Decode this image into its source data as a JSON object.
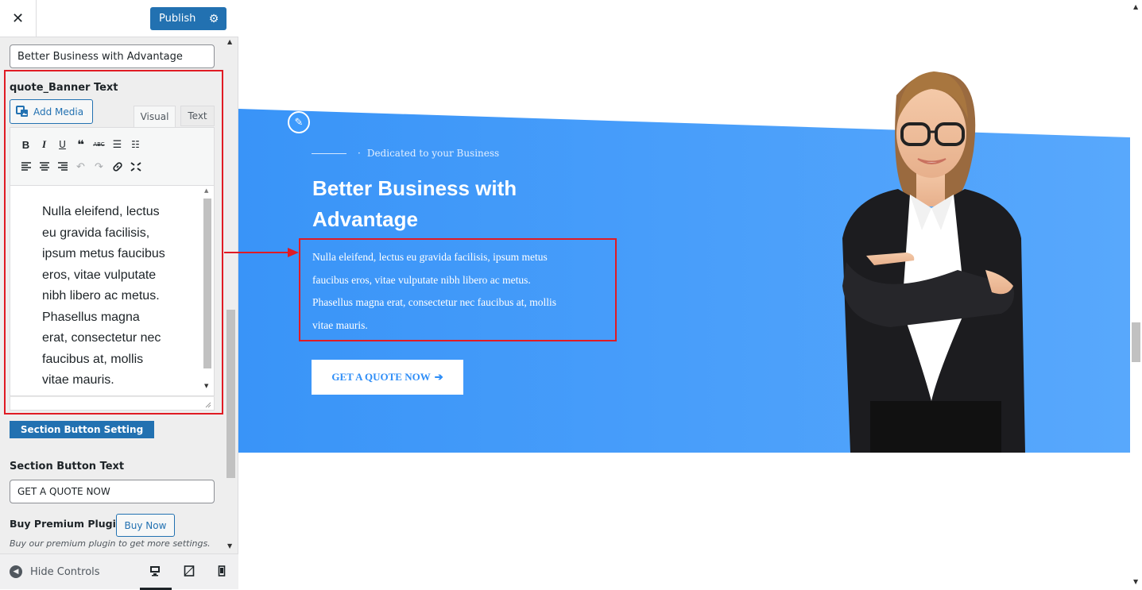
{
  "topbar": {
    "close_label": "✕",
    "publish_label": "Publish"
  },
  "sidebar": {
    "title_value": "Better Business with Advantage",
    "quote_label": "quote_Banner Text",
    "add_media_label": "Add Media",
    "tab_visual": "Visual",
    "tab_text": "Text",
    "toolbar_row1": [
      "B",
      "I",
      "U",
      "❝",
      "ABC",
      "list",
      "olist"
    ],
    "toolbar_row2": [
      "align-left",
      "align-center",
      "align-right",
      "undo",
      "redo",
      "link",
      "fullscreen"
    ],
    "editor_lines": [
      "Nulla eleifend, lectus",
      "eu gravida facilisis,",
      "ipsum metus faucibus",
      "eros, vitae vulputate",
      "nibh libero ac metus.",
      "Phasellus magna",
      "erat, consectetur nec",
      "faucibus at, mollis",
      "vitae mauris."
    ],
    "section_button_setting": "Section Button Setting",
    "section_button_text_label": "Section Button Text",
    "section_button_text_value": "GET A QUOTE NOW",
    "premium_label": "Buy Premium Plugin",
    "buy_now_label": "Buy Now",
    "premium_desc": "Buy our premium plugin to get more settings."
  },
  "bottombar": {
    "hide_controls": "Hide Controls"
  },
  "preview": {
    "tagline": "Dedicated to your Business",
    "title_line1": "Better Business with",
    "title_line2": "Advantage",
    "para_lines": [
      "Nulla eleifend, lectus eu gravida facilisis, ipsum metus",
      "faucibus eros, vitae vulputate nibh libero ac metus.",
      "Phasellus magna erat, consectetur nec faucibus at, mollis",
      "vitae mauris."
    ],
    "quote_button": "GET A QUOTE NOW",
    "banner_color_left": "#3994f8",
    "banner_color_right": "#58a8fc"
  },
  "colors": {
    "accent": "#2271b1",
    "highlight": "#e01b24"
  }
}
